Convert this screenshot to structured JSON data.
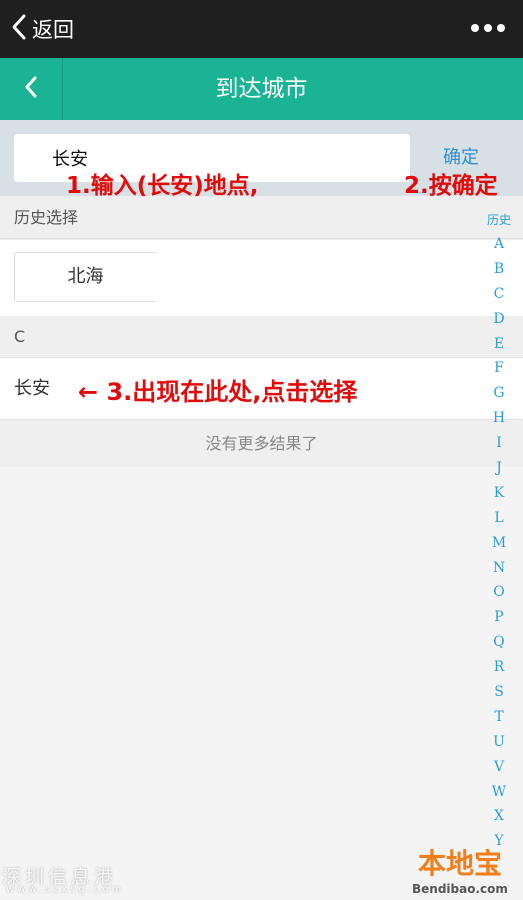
{
  "wechat_bar": {
    "back_label": "返回"
  },
  "header": {
    "title": "到达城市"
  },
  "search": {
    "value": "长安",
    "confirm_label": "确定"
  },
  "annotations": {
    "step1": "1.输入(长安)地点,",
    "step2": "2.按确定",
    "step3": "← 3.出现在此处,点击选择"
  },
  "history": {
    "section_label": "历史选择",
    "items": [
      "北海"
    ]
  },
  "results": {
    "section_label": "C",
    "items": [
      "长安"
    ],
    "no_more_text": "没有更多结果了"
  },
  "alpha_index": {
    "head": "历史",
    "letters": [
      "A",
      "B",
      "C",
      "D",
      "E",
      "F",
      "G",
      "H",
      "I",
      "J",
      "K",
      "L",
      "M",
      "N",
      "O",
      "P",
      "Q",
      "R",
      "S",
      "T",
      "U",
      "V",
      "W",
      "X",
      "Y"
    ]
  },
  "watermarks": {
    "left_text": "深圳信息港",
    "left_sub": "www.szxsg.com",
    "logo_text": "本地宝",
    "logo_sub": "Bendibao.com"
  },
  "colors": {
    "header_green": "#1ab394",
    "wechat_bar": "#1f1f1f",
    "annotation_red": "#e10b0b",
    "link_blue": "#2b8fd0",
    "index_blue": "#2a9fd6"
  }
}
